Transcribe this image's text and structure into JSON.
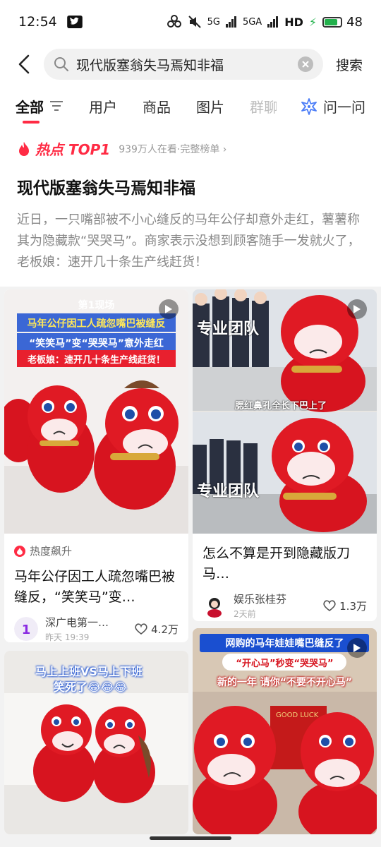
{
  "status": {
    "time": "12:54",
    "battery": "48",
    "hd": "HD",
    "net1": "5G",
    "net2": "5GA"
  },
  "search": {
    "query": "现代版塞翁失马焉知非福",
    "button": "搜索"
  },
  "tabs": [
    "全部",
    "用户",
    "商品",
    "图片",
    "群聊"
  ],
  "ask_label": "问一问",
  "hot": {
    "badge": "热点",
    "rank": "TOP1",
    "meta": "939万人在看·完整榜单",
    "title": "现代版塞翁失马焉知非福",
    "summary": "近日，一只嘴部被不小心缝反的马年公仔却意外走红，薯薯称其为隐藏款“哭哭马”。商家表示没想到顾客随手一发就火了，老板娘：速开几十条生产线赶货！"
  },
  "cards": [
    {
      "thumb_brand": "第1现场",
      "thumb_line1": "马年公仔因工人疏忽嘴巴被缝反",
      "thumb_line2": "“笑笑马”变“哭哭马”意外走红",
      "thumb_line3": "老板娘：速开几十条生产线赶货！",
      "tag": "热度飙升",
      "title": "马年公仔因工人疏忽嘴巴被缝反，“笑笑马”变…",
      "author": "深广电第一…",
      "date": "昨天 19:39",
      "likes": "4.2万"
    },
    {
      "thumb_text1": "专业团队",
      "thumb_sub": "腮红鼻孔全长下巴上了",
      "thumb_text2": "专业团队",
      "title": "怎么不算是开到隐藏版刀马…",
      "author": "娱乐张桂芬",
      "date": "2天前",
      "likes": "1.3万"
    },
    {
      "thumb_line1": "马上上班VS马上下班",
      "thumb_line2": "笑死了😂😂😂"
    },
    {
      "thumb_line1": "网购的马年娃娃嘴巴缝反了",
      "thumb_line2": "“开心马”秒变“哭哭马”",
      "thumb_line3": "新的一年 请你“不要不开心马”",
      "thumb_sign": "GOOD LUCK"
    }
  ],
  "colors": {
    "accent": "#ff2b44",
    "ask": "#4a7cf7"
  }
}
